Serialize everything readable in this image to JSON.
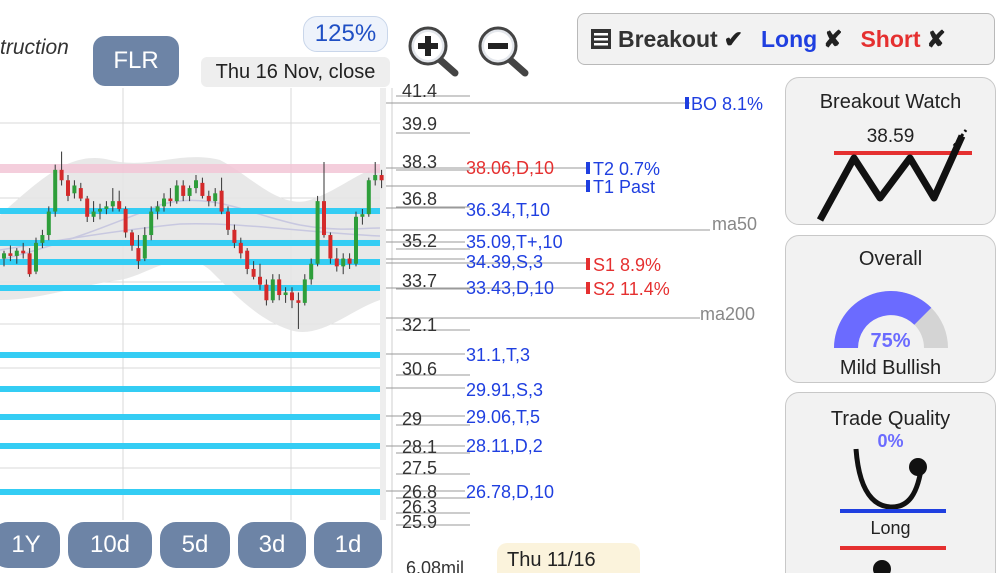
{
  "header": {
    "title_fragment": "truction",
    "ticker": "FLR",
    "zoom": "125%",
    "date_label": "Thu 16 Nov, close"
  },
  "toolbar": {
    "zoom_in_icon": "magnifier-plus-icon",
    "zoom_out_icon": "magnifier-minus-icon"
  },
  "signals": {
    "items": [
      {
        "label": "Breakout",
        "state": "✔",
        "color": "#333333",
        "icon": "list-icon"
      },
      {
        "label": "Long",
        "state": "✘",
        "color": "#1f3fe0"
      },
      {
        "label": "Short",
        "state": "✘",
        "color": "#e53030"
      }
    ]
  },
  "axis": {
    "ticks": [
      "41.4",
      "39.9",
      "38.3",
      "36.8",
      "35.2",
      "33.7",
      "32.1",
      "30.6",
      "29",
      "28.1",
      "27.5",
      "26.8",
      "26.3",
      "25.9"
    ],
    "volume": "6.08mil"
  },
  "levels": [
    {
      "label": "36.34,T,10",
      "color": "#1f3fe0"
    },
    {
      "label": "35.09,T+,10",
      "color": "#1f3fe0"
    },
    {
      "label": "34.39,S,3",
      "color": "#1f3fe0"
    },
    {
      "label": "33.43,D,10",
      "color": "#1f3fe0"
    },
    {
      "label": "31.1,T,3",
      "color": "#1f3fe0"
    },
    {
      "label": "29.91,S,3",
      "color": "#1f3fe0"
    },
    {
      "label": "29.06,T,5",
      "color": "#1f3fe0"
    },
    {
      "label": "28.11,D,2",
      "color": "#1f3fe0"
    },
    {
      "label": "26.78,D,10",
      "color": "#1f3fe0"
    },
    {
      "label": "38.06,D,10",
      "color": "#e53030"
    }
  ],
  "markers": [
    {
      "label": "BO 8.1%",
      "color": "#1f3fe0"
    },
    {
      "label": "T2 0.7%",
      "color": "#1f3fe0"
    },
    {
      "label": "T1 Past",
      "color": "#1f3fe0"
    },
    {
      "label": "S1 8.9%",
      "color": "#e53030"
    },
    {
      "label": "S2 11.4%",
      "color": "#e53030"
    }
  ],
  "moving_averages": [
    {
      "label": "ma50"
    },
    {
      "label": "ma200"
    }
  ],
  "panels": {
    "breakout_watch": {
      "title": "Breakout Watch",
      "value": "38.59"
    },
    "overall": {
      "title": "Overall",
      "percent": "75%",
      "level": 0.75,
      "label": "Mild Bullish"
    },
    "trade_quality": {
      "title": "Trade Quality",
      "percent": "0%",
      "label": "Long"
    }
  },
  "periods": [
    "1Y",
    "10d",
    "5d",
    "3d",
    "1d"
  ],
  "bottom": {
    "date": "Thu 11/16"
  },
  "chart_data": {
    "type": "candlestick",
    "price_axis_ticks": [
      41.4,
      39.9,
      38.3,
      36.8,
      35.2,
      33.7,
      32.1,
      30.6,
      29,
      28.1,
      27.5,
      26.8,
      26.3,
      25.9
    ],
    "candles": [
      {
        "o": 34.6,
        "h": 34.9,
        "l": 34.3,
        "c": 34.8
      },
      {
        "o": 34.8,
        "h": 35.1,
        "l": 34.5,
        "c": 34.7
      },
      {
        "o": 34.7,
        "h": 35.0,
        "l": 34.4,
        "c": 34.9
      },
      {
        "o": 34.9,
        "h": 35.2,
        "l": 34.6,
        "c": 34.8
      },
      {
        "o": 34.8,
        "h": 35.0,
        "l": 33.9,
        "c": 34.0
      },
      {
        "o": 34.1,
        "h": 35.4,
        "l": 34.0,
        "c": 35.2
      },
      {
        "o": 35.2,
        "h": 35.7,
        "l": 35.0,
        "c": 35.5
      },
      {
        "o": 35.5,
        "h": 36.6,
        "l": 35.3,
        "c": 36.4
      },
      {
        "o": 36.4,
        "h": 38.2,
        "l": 36.2,
        "c": 38.0
      },
      {
        "o": 38.0,
        "h": 38.7,
        "l": 37.4,
        "c": 37.6
      },
      {
        "o": 37.6,
        "h": 37.8,
        "l": 36.8,
        "c": 37.0
      },
      {
        "o": 37.1,
        "h": 37.6,
        "l": 36.9,
        "c": 37.4
      },
      {
        "o": 37.3,
        "h": 37.5,
        "l": 36.8,
        "c": 36.9
      },
      {
        "o": 36.9,
        "h": 37.0,
        "l": 36.0,
        "c": 36.2
      },
      {
        "o": 36.2,
        "h": 36.8,
        "l": 36.0,
        "c": 36.4
      },
      {
        "o": 36.4,
        "h": 36.7,
        "l": 36.1,
        "c": 36.5
      },
      {
        "o": 36.5,
        "h": 36.8,
        "l": 36.3,
        "c": 36.6
      },
      {
        "o": 36.6,
        "h": 37.3,
        "l": 36.4,
        "c": 36.8
      },
      {
        "o": 36.8,
        "h": 37.2,
        "l": 36.4,
        "c": 36.5
      },
      {
        "o": 36.5,
        "h": 36.6,
        "l": 35.4,
        "c": 35.6
      },
      {
        "o": 35.6,
        "h": 35.7,
        "l": 34.9,
        "c": 35.1
      },
      {
        "o": 35.0,
        "h": 35.5,
        "l": 34.2,
        "c": 34.5
      },
      {
        "o": 34.6,
        "h": 35.8,
        "l": 34.5,
        "c": 35.5
      },
      {
        "o": 35.5,
        "h": 36.6,
        "l": 35.3,
        "c": 36.4
      },
      {
        "o": 36.4,
        "h": 36.8,
        "l": 36.1,
        "c": 36.6
      },
      {
        "o": 36.6,
        "h": 37.1,
        "l": 36.4,
        "c": 36.9
      },
      {
        "o": 36.9,
        "h": 37.3,
        "l": 36.6,
        "c": 36.8
      },
      {
        "o": 36.8,
        "h": 37.6,
        "l": 36.7,
        "c": 37.4
      },
      {
        "o": 37.4,
        "h": 37.6,
        "l": 36.8,
        "c": 37.0
      },
      {
        "o": 37.0,
        "h": 37.4,
        "l": 36.8,
        "c": 37.3
      },
      {
        "o": 37.3,
        "h": 37.8,
        "l": 37.1,
        "c": 37.6
      },
      {
        "o": 37.5,
        "h": 37.7,
        "l": 36.9,
        "c": 37.0
      },
      {
        "o": 37.0,
        "h": 37.2,
        "l": 36.6,
        "c": 36.8
      },
      {
        "o": 36.8,
        "h": 37.3,
        "l": 36.6,
        "c": 37.1
      },
      {
        "o": 37.2,
        "h": 37.7,
        "l": 36.3,
        "c": 36.4
      },
      {
        "o": 36.4,
        "h": 36.6,
        "l": 35.5,
        "c": 35.7
      },
      {
        "o": 35.7,
        "h": 35.9,
        "l": 35.0,
        "c": 35.2
      },
      {
        "o": 35.2,
        "h": 35.4,
        "l": 34.6,
        "c": 34.8
      },
      {
        "o": 34.9,
        "h": 35.0,
        "l": 34.0,
        "c": 34.2
      },
      {
        "o": 34.2,
        "h": 34.5,
        "l": 33.8,
        "c": 33.9
      },
      {
        "o": 33.9,
        "h": 34.4,
        "l": 33.4,
        "c": 33.6
      },
      {
        "o": 33.6,
        "h": 33.8,
        "l": 32.8,
        "c": 33.0
      },
      {
        "o": 33.0,
        "h": 34.0,
        "l": 32.9,
        "c": 33.8
      },
      {
        "o": 33.8,
        "h": 34.0,
        "l": 33.0,
        "c": 33.2
      },
      {
        "o": 33.2,
        "h": 33.5,
        "l": 32.9,
        "c": 33.3
      },
      {
        "o": 33.3,
        "h": 33.5,
        "l": 32.7,
        "c": 33.0
      },
      {
        "o": 33.0,
        "h": 33.3,
        "l": 31.9,
        "c": 32.9
      },
      {
        "o": 32.9,
        "h": 34.0,
        "l": 32.8,
        "c": 33.8
      },
      {
        "o": 33.8,
        "h": 34.6,
        "l": 33.6,
        "c": 34.4
      },
      {
        "o": 34.4,
        "h": 37.0,
        "l": 34.3,
        "c": 36.8
      },
      {
        "o": 36.8,
        "h": 38.3,
        "l": 35.4,
        "c": 35.5
      },
      {
        "o": 35.5,
        "h": 35.6,
        "l": 34.4,
        "c": 34.6
      },
      {
        "o": 34.6,
        "h": 35.0,
        "l": 34.1,
        "c": 34.3
      },
      {
        "o": 34.3,
        "h": 34.8,
        "l": 34.0,
        "c": 34.6
      },
      {
        "o": 34.6,
        "h": 34.8,
        "l": 34.2,
        "c": 34.4
      },
      {
        "o": 34.4,
        "h": 36.4,
        "l": 34.3,
        "c": 36.2
      },
      {
        "o": 36.2,
        "h": 36.5,
        "l": 35.9,
        "c": 36.3
      },
      {
        "o": 36.3,
        "h": 37.7,
        "l": 36.2,
        "c": 37.6
      },
      {
        "o": 37.6,
        "h": 38.3,
        "l": 37.4,
        "c": 37.8
      },
      {
        "o": 37.8,
        "h": 38.0,
        "l": 37.3,
        "c": 37.6
      }
    ]
  }
}
